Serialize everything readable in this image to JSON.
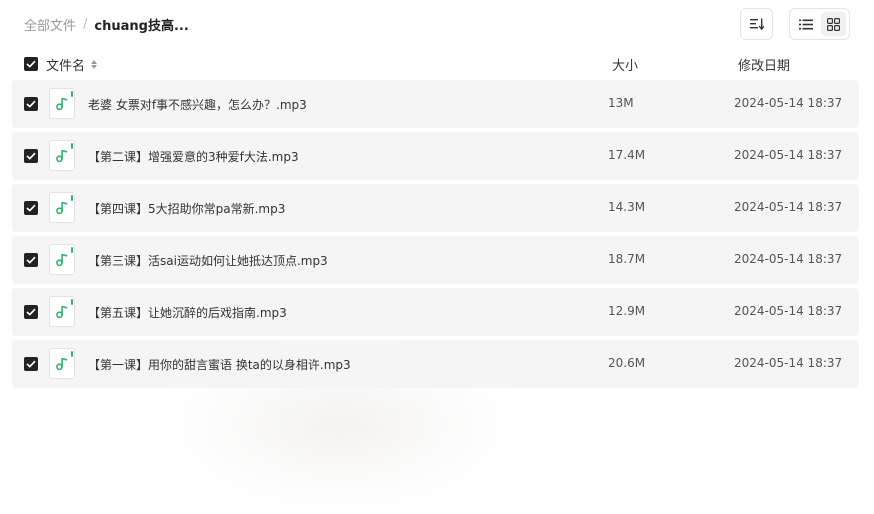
{
  "breadcrumb": {
    "root": "全部文件",
    "separator": "/",
    "current": "chuang技高..."
  },
  "toolbar": {
    "sort_icon": "sort-icon",
    "list_icon": "list-view-icon",
    "grid_icon": "grid-view-icon",
    "active_view": "grid"
  },
  "table": {
    "columns": {
      "name": "文件名",
      "size": "大小",
      "date": "修改日期"
    },
    "rows": [
      {
        "name": "老婆 女票对f事不感兴趣，怎么办？.mp3",
        "size": "13M",
        "date": "2024-05-14 18:37",
        "checked": true
      },
      {
        "name": "【第二课】增强爱意的3种爱f大法.mp3",
        "size": "17.4M",
        "date": "2024-05-14 18:37",
        "checked": true
      },
      {
        "name": "【第四课】5大招助你常pa常新.mp3",
        "size": "14.3M",
        "date": "2024-05-14 18:37",
        "checked": true
      },
      {
        "name": "【第三课】活sai运动如何让她抵达顶点.mp3",
        "size": "18.7M",
        "date": "2024-05-14 18:37",
        "checked": true
      },
      {
        "name": "【第五课】让她沉醉的后戏指南.mp3",
        "size": "12.9M",
        "date": "2024-05-14 18:37",
        "checked": true
      },
      {
        "name": "【第一课】用你的甜言蜜语 换ta的以身相许.mp3",
        "size": "20.6M",
        "date": "2024-05-14 18:37",
        "checked": true
      }
    ]
  },
  "colors": {
    "accent_green": "#2fb36e",
    "row_bg": "#f5f5f5",
    "checkbox": "#222222"
  }
}
